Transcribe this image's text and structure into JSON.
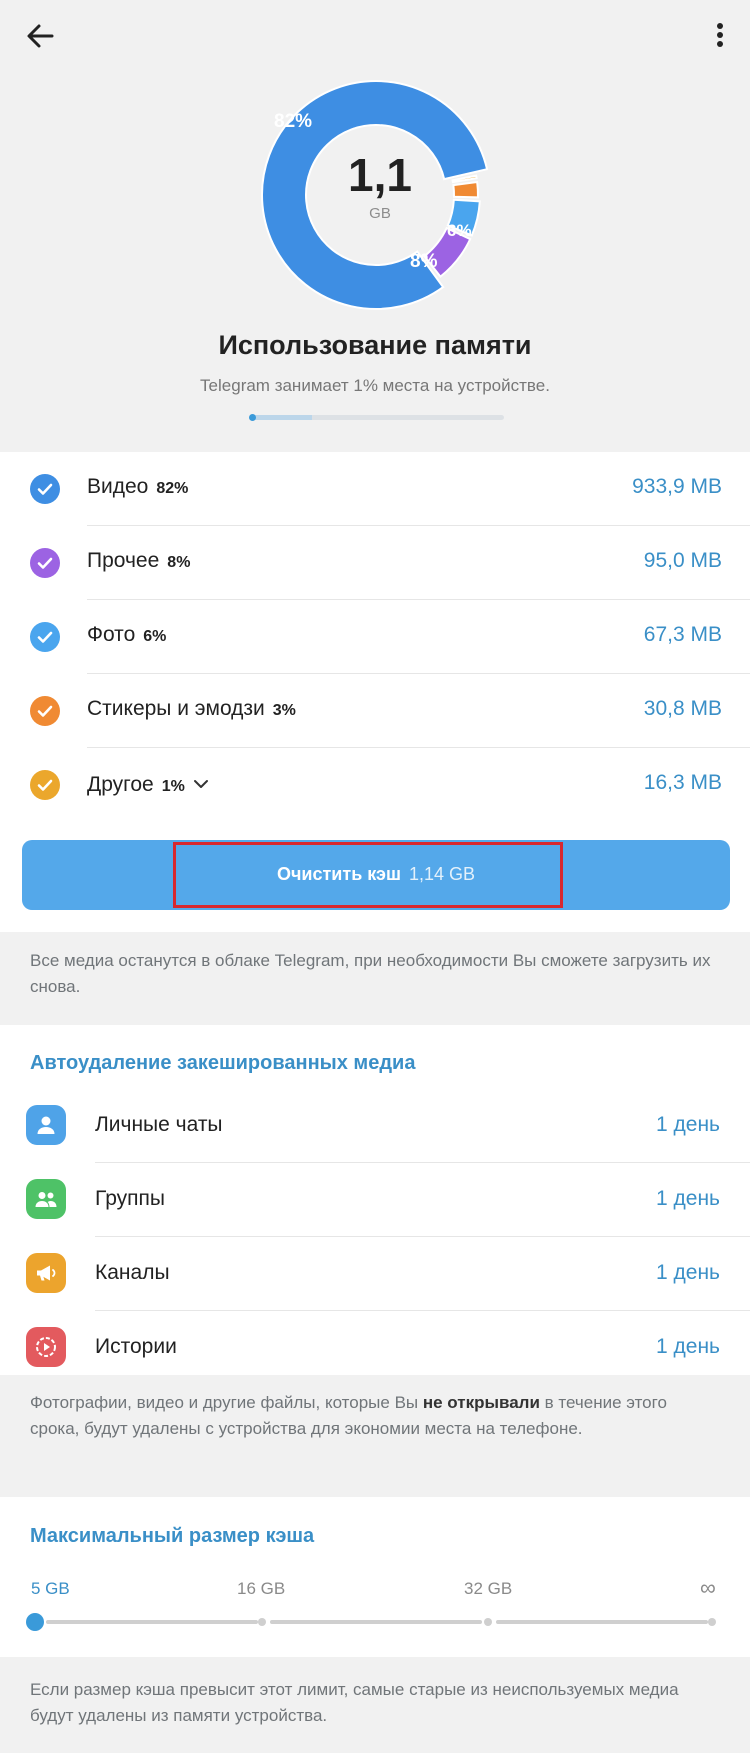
{
  "header": {
    "back_icon": "arrow-left-icon",
    "more_icon": "more-vertical-icon"
  },
  "chart_data": {
    "type": "pie",
    "center_value": "1,1",
    "center_unit": "GB",
    "slices": [
      {
        "label": "Видео",
        "value": 82,
        "color": "#3e8ee3",
        "shown_label": "82%"
      },
      {
        "label": "Прочее",
        "value": 8,
        "color": "#9c63e3",
        "shown_label": "8%"
      },
      {
        "label": "Фото",
        "value": 6,
        "color": "#4aa5ee",
        "shown_label": "6%"
      },
      {
        "label": "Стикеры и эмодзи",
        "value": 3,
        "color": "#f08a33",
        "shown_label": ""
      },
      {
        "label": "Другое",
        "value": 1,
        "color": "#eba72c",
        "shown_label": ""
      }
    ]
  },
  "summary": {
    "title": "Использование памяти",
    "subtitle": "Telegram занимает 1% места на устройстве.",
    "device_usage_fraction": 0.01
  },
  "storage": {
    "items": [
      {
        "name": "Видео",
        "percent": "82%",
        "size": "933,9 MB",
        "color": "#3e8ee3",
        "checked": true
      },
      {
        "name": "Прочее",
        "percent": "8%",
        "size": "95,0 MB",
        "color": "#9c63e3",
        "checked": true
      },
      {
        "name": "Фото",
        "percent": "6%",
        "size": "67,3 MB",
        "color": "#4aa5ee",
        "checked": true
      },
      {
        "name": "Стикеры и эмодзи",
        "percent": "3%",
        "size": "30,8 MB",
        "color": "#f08a33",
        "checked": true
      },
      {
        "name": "Другое",
        "percent": "1%",
        "size": "16,3 MB",
        "color": "#eba72c",
        "checked": true,
        "expand_icon": "chevron-down-icon"
      }
    ],
    "clear_button": {
      "label": "Очистить кэш",
      "size": "1,14 GB"
    },
    "note": "Все медиа останутся в облаке Telegram, при необходимости Вы сможете загрузить их снова."
  },
  "autodelete": {
    "title": "Автоудаление закешированных медиа",
    "items": [
      {
        "name": "Личные чаты",
        "value": "1 день",
        "icon": "person-icon",
        "color": "#4fa3e8"
      },
      {
        "name": "Группы",
        "value": "1 день",
        "icon": "group-icon",
        "color": "#4ec267"
      },
      {
        "name": "Каналы",
        "value": "1 день",
        "icon": "megaphone-icon",
        "color": "#eca42d"
      },
      {
        "name": "Истории",
        "value": "1 день",
        "icon": "stories-icon",
        "color": "#e35a5e"
      }
    ],
    "note_before": "Фотографии, видео и другие файлы, которые Вы ",
    "note_bold": "не открывали",
    "note_after": " в течение этого срока, будут удалены с устройства для экономии места на телефоне."
  },
  "max_cache": {
    "title": "Максимальный размер кэша",
    "options": [
      "5 GB",
      "16 GB",
      "32 GB",
      "∞"
    ],
    "selected": "5 GB",
    "note": "Если размер кэша превысит этот лимит, самые старые из неиспользуемых медиа будут удалены из памяти устройства."
  }
}
